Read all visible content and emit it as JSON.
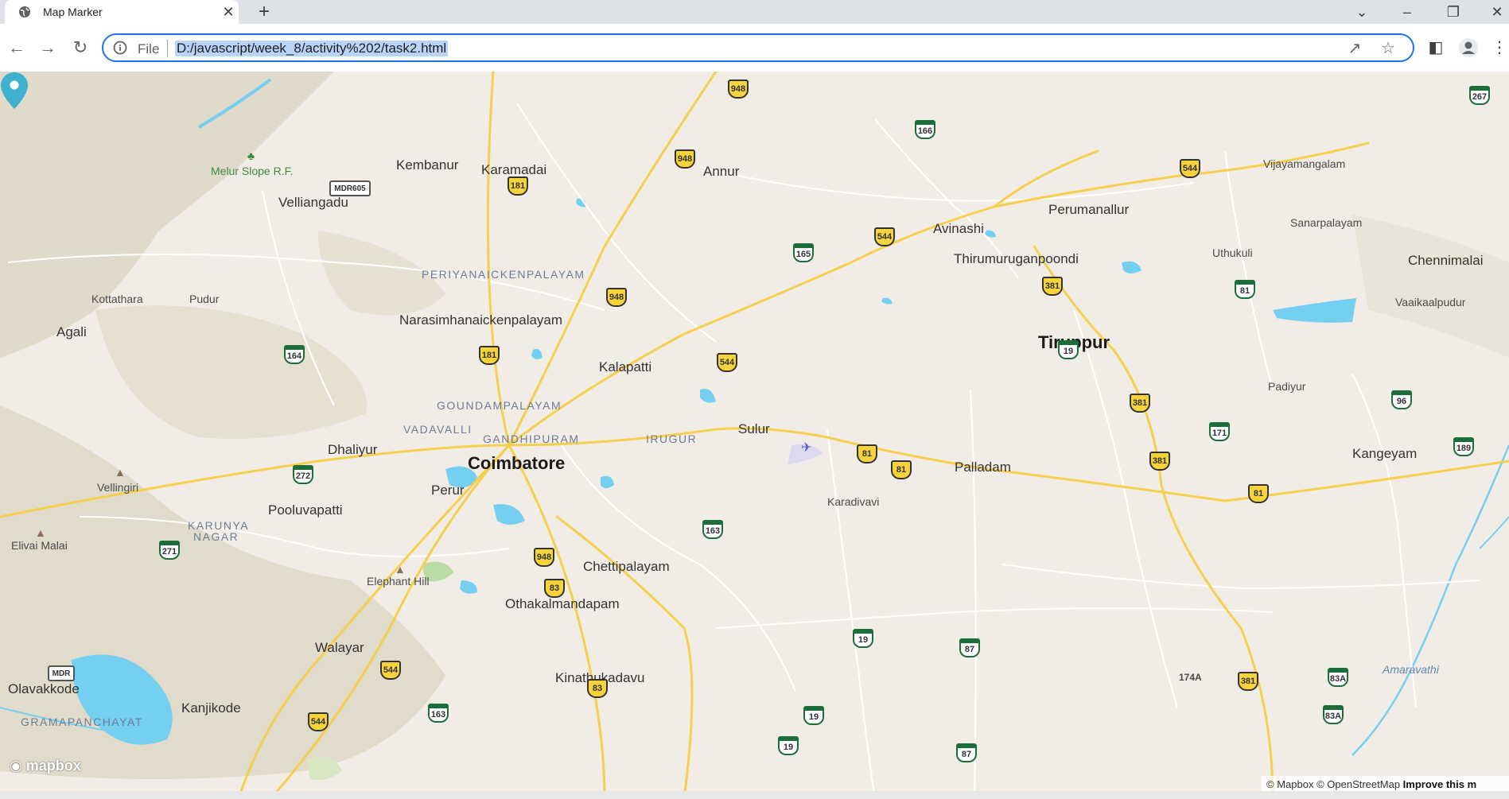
{
  "tab": {
    "title": "Map Marker"
  },
  "controls": {
    "new_tab": "+",
    "close_tab": "✕",
    "minimize": "–",
    "restore": "❐",
    "close_window": "✕",
    "tab_list": "⌄"
  },
  "address_bar": {
    "scheme_label": "File",
    "url": "D:/javascript/week_8/activity%202/task2.html"
  },
  "map": {
    "marker": {
      "label": "Sulur",
      "color": "#3fb1ce"
    },
    "places": {
      "coimbatore": "Coimbatore",
      "tiruppur": "Tiruppur",
      "sulur": "Sulur",
      "palladam": "Palladam",
      "annur": "Annur",
      "avinashi": "Avinashi",
      "perumanallur": "Perumanallur",
      "thirumuruganpoondi": "Thirumuruganpoondi",
      "kalapatti": "Kalapatti",
      "narasimhanaickenpalayam": "Narasimhanaickenpalayam",
      "kembanur": "Kembanur",
      "karamadai": "Karamadai",
      "velliangadu": "Velliangadu",
      "agali": "Agali",
      "kottathara": "Kottathara",
      "pudur": "Pudur",
      "dhaliyur": "Dhaliyur",
      "perur": "Perur",
      "pooluvapatti": "Pooluvapatti",
      "chettipalayam": "Chettipalayam",
      "othakalmandapam": "Othakalmandapam",
      "kinathukadavu": "Kinathukadavu",
      "walayar": "Walayar",
      "kanjikode": "Kanjikode",
      "olavakkode": "Olavakkode",
      "kangeyam": "Kangeyam",
      "chennimalai": "Chennimalai",
      "vaaikaalpudur": "Vaaikaalpudur",
      "sanarpalayam": "Sanarpalayam",
      "vijayamangalam": "Vijayamangalam",
      "uthukuli": "Uthukuli",
      "padiyur": "Padiyur",
      "karadivavi": "Karadivavi",
      "vellingiri": "Vellingiri",
      "elivai_malai": "Elivai Malai",
      "elephant_hill": "Elephant Hill",
      "melur_slope": "Melur Slope R.F.",
      "amaravathi": "Amaravathi",
      "periyanaickenpalayam": "PERIYANAICKENPALAYAM",
      "goundampalayam": "GOUNDAMPALAYAM",
      "vadavalli": "VADAVALLI",
      "gandhipuram": "GANDHIPURAM",
      "irugur": "IRUGUR",
      "karunya_nagar_1": "KARUNYA",
      "karunya_nagar_2": "NAGAR",
      "gramapanchayat": "GRAMAPANCHAYAT"
    },
    "shields": {
      "s948a": "948",
      "s948b": "948",
      "s948c": "948",
      "s948d": "948",
      "s181a": "181",
      "s181b": "181",
      "s544a": "544",
      "s544b": "544",
      "s544c": "544",
      "s544d": "544",
      "s544e": "544",
      "s166": "166",
      "s165": "165",
      "s381a": "381",
      "s381b": "381",
      "s381c": "381",
      "s381d": "381",
      "s81a": "81",
      "s81b": "81",
      "s81c": "81",
      "s81d": "81",
      "s19a": "19",
      "s19b": "19",
      "s19c": "19",
      "s19d": "19",
      "s163a": "163",
      "s163b": "163",
      "s83a": "83",
      "s83b": "83",
      "s164": "164",
      "s272": "272",
      "s271": "271",
      "s171": "171",
      "s96": "96",
      "s189": "189",
      "s267": "267",
      "s87a": "87",
      "s87b": "87",
      "s83aa": "83A",
      "s83ab": "83A",
      "mdr605": "MDR605",
      "mdr": "MDR",
      "r174a": "174A"
    },
    "attribution": {
      "mapbox": "© Mapbox",
      "osm": "© OpenStreetMap",
      "improve": "Improve this m"
    },
    "logo": "mapbox",
    "colors": {
      "land": "#f1ede6",
      "water": "#75cff0",
      "major_road": "#f6cf4e",
      "minor_road": "#ffffff",
      "hills": "#d9d3c3"
    }
  }
}
